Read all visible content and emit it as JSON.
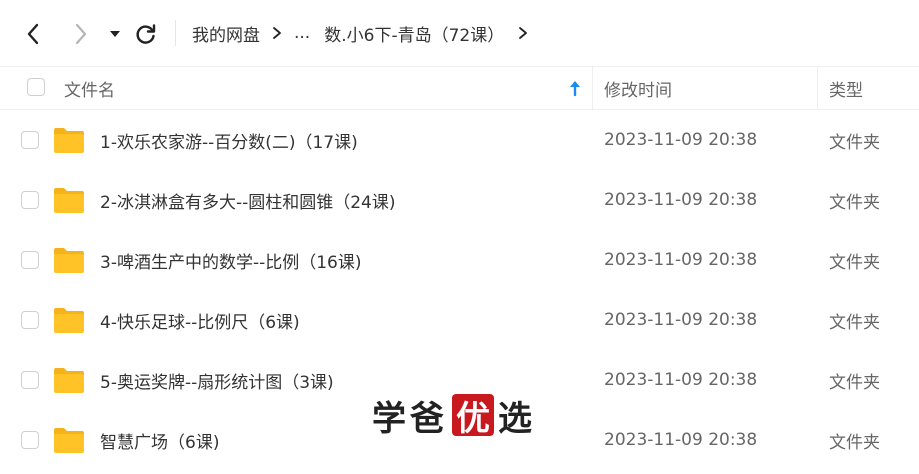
{
  "toolbar": {
    "back_icon": "chevron-left-icon",
    "forward_icon": "chevron-right-icon",
    "dropdown_icon": "caret-down-icon",
    "refresh_icon": "refresh-icon"
  },
  "breadcrumb": {
    "root": "我的网盘",
    "ellipsis": "...",
    "current": "数.小6下-青岛（72课）"
  },
  "header": {
    "name": "文件名",
    "modified": "修改时间",
    "type": "类型",
    "sort_icon": "arrow-up-icon"
  },
  "rows": [
    {
      "name": "1-欢乐农家游--百分数(二)（17课)",
      "modified": "2023-11-09 20:38",
      "type": "文件夹"
    },
    {
      "name": "2-冰淇淋盒有多大--圆柱和圆锥（24课)",
      "modified": "2023-11-09 20:38",
      "type": "文件夹"
    },
    {
      "name": "3-啤酒生产中的数学--比例（16课)",
      "modified": "2023-11-09 20:38",
      "type": "文件夹"
    },
    {
      "name": "4-快乐足球--比例尺（6课)",
      "modified": "2023-11-09 20:38",
      "type": "文件夹"
    },
    {
      "name": "5-奥运奖牌--扇形统计图（3课)",
      "modified": "2023-11-09 20:38",
      "type": "文件夹"
    },
    {
      "name": "智慧广场（6课)",
      "modified": "2023-11-09 20:38",
      "type": "文件夹"
    }
  ],
  "watermark": {
    "part1": "学爸",
    "highlight": "优",
    "part2": "选"
  },
  "colors": {
    "accent": "#1a8cf0",
    "folder": "#ffc328",
    "folder_dark": "#f5b21b",
    "watermark_red": "#c8191f"
  }
}
